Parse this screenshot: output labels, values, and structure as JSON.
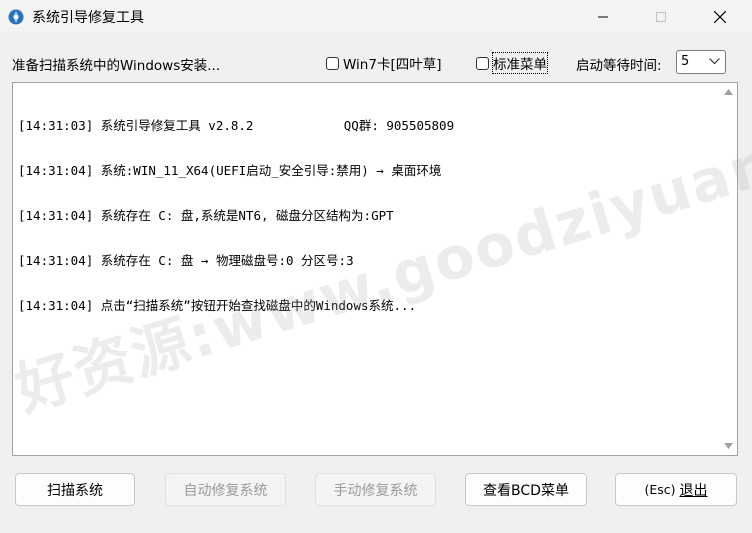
{
  "window": {
    "title": "系统引导修复工具"
  },
  "toolbar": {
    "status_text": "准备扫描系统中的Windows安装...",
    "win7_checkbox_label": "Win7卡[四叶草]",
    "standard_menu_checkbox_label": "标准菜单",
    "wait_time_label": "启动等待时间:",
    "wait_time_value": "5"
  },
  "log": {
    "lines": [
      "[14:31:03] 系统引导修复工具 v2.8.2            QQ群: 905505809",
      "[14:31:04] 系统:WIN_11_X64(UEFI启动_安全引导:禁用) → 桌面环境",
      "[14:31:04] 系统存在 C: 盘,系统是NT6, 磁盘分区结构为:GPT",
      "[14:31:04] 系统存在 C: 盘 → 物理磁盘号:0 分区号:3",
      "[14:31:04] 点击“扫描系统”按钮开始查找磁盘中的Windows系统..."
    ]
  },
  "watermark": "好资源:www.goodziyuan.com",
  "buttons": {
    "scan": "扫描系统",
    "auto_repair": "自动修复系统",
    "manual_repair": "手动修复系统",
    "view_bcd": "查看BCD菜单",
    "exit_prefix": "(Esc) ",
    "exit_label": "退出"
  },
  "colors": {
    "window_bg": "#f0f0f0",
    "disabled_text": "#9a9a9a"
  },
  "icons": {
    "app": "app-icon",
    "minimize": "minimize-icon",
    "maximize": "maximize-icon",
    "close": "close-icon",
    "dropdown": "chevron-down-icon",
    "scroll_up": "scroll-up-icon",
    "scroll_down": "scroll-down-icon"
  }
}
